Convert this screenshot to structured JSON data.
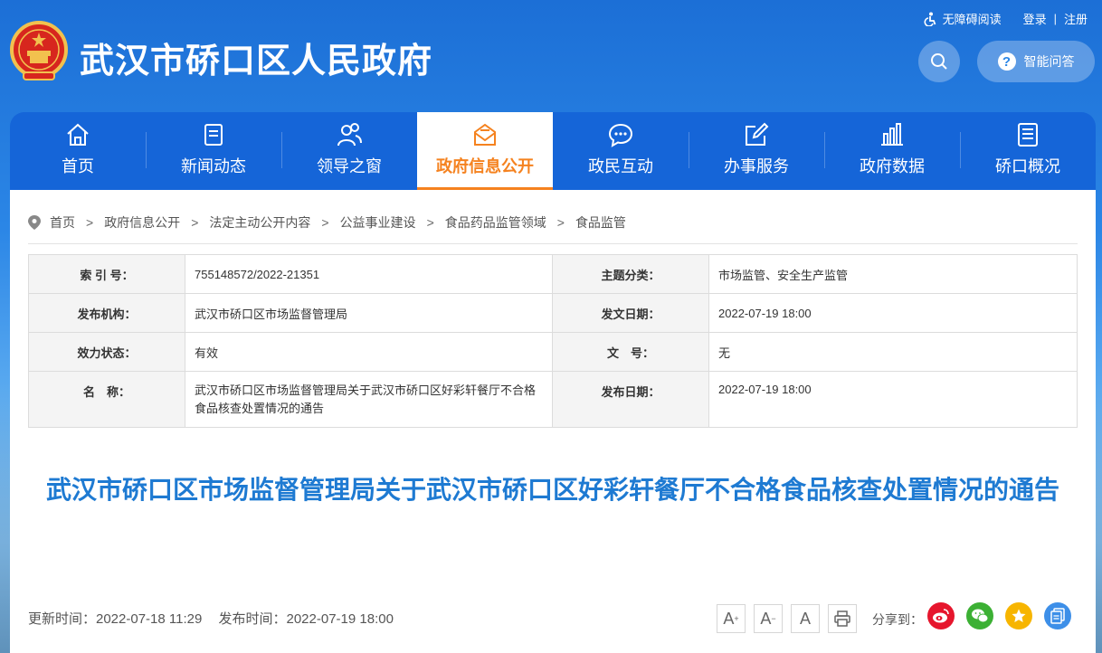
{
  "header": {
    "site_title": "武汉市硚口区人民政府",
    "accessibility": "无障碍阅读",
    "login": "登录",
    "divider": "|",
    "register": "注册",
    "qa_label": "智能问答",
    "qa_icon_glyph": "?"
  },
  "nav": {
    "items": [
      {
        "label": "首页",
        "icon": "home-icon"
      },
      {
        "label": "新闻动态",
        "icon": "news-icon"
      },
      {
        "label": "领导之窗",
        "icon": "leaders-icon"
      },
      {
        "label": "政府信息公开",
        "icon": "mail-icon",
        "active": true
      },
      {
        "label": "政民互动",
        "icon": "chat-icon"
      },
      {
        "label": "办事服务",
        "icon": "edit-icon"
      },
      {
        "label": "政府数据",
        "icon": "bar-chart-icon"
      },
      {
        "label": "硚口概况",
        "icon": "document-icon"
      }
    ]
  },
  "breadcrumb": {
    "separator": ">",
    "items": [
      "首页",
      "政府信息公开",
      "法定主动公开内容",
      "公益事业建设",
      "食品药品监管领域",
      "食品监管"
    ]
  },
  "meta": {
    "index_label": "索 引 号：",
    "index_value": "755148572/2022-21351",
    "topic_label": "主题分类：",
    "topic_value": "市场监管、安全生产监管",
    "publisher_label": "发布机构：",
    "publisher_value": "武汉市硚口区市场监督管理局",
    "issue_date_label": "发文日期：",
    "issue_date_value": "2022-07-19 18:00",
    "status_label": "效力状态：",
    "status_value": "有效",
    "docno_label": "文　号：",
    "docno_value": "无",
    "name_label": "名　称：",
    "name_value": "武汉市硚口区市场监督管理局关于武汉市硚口区好彩轩餐厅不合格食品核查处置情况的通告",
    "publish_date_label": "发布日期：",
    "publish_date_value": "2022-07-19 18:00"
  },
  "article": {
    "title": "武汉市硚口区市场监督管理局关于武汉市硚口区好彩轩餐厅不合格食品核查处置情况的通告",
    "updated": "更新时间：2022-07-18 11:29",
    "published": "发布时间：2022-07-19 18:00"
  },
  "tools": {
    "font_large": "A",
    "font_small": "A",
    "font_default": "A",
    "share_label": "分享到："
  },
  "colors": {
    "nav_bg": "#1565d8",
    "active": "#f5821f",
    "title": "#1e7ad2",
    "weibo": "#e6162d",
    "wechat": "#3cb034",
    "favorite": "#f7b500",
    "copy": "#3d8fe8"
  }
}
